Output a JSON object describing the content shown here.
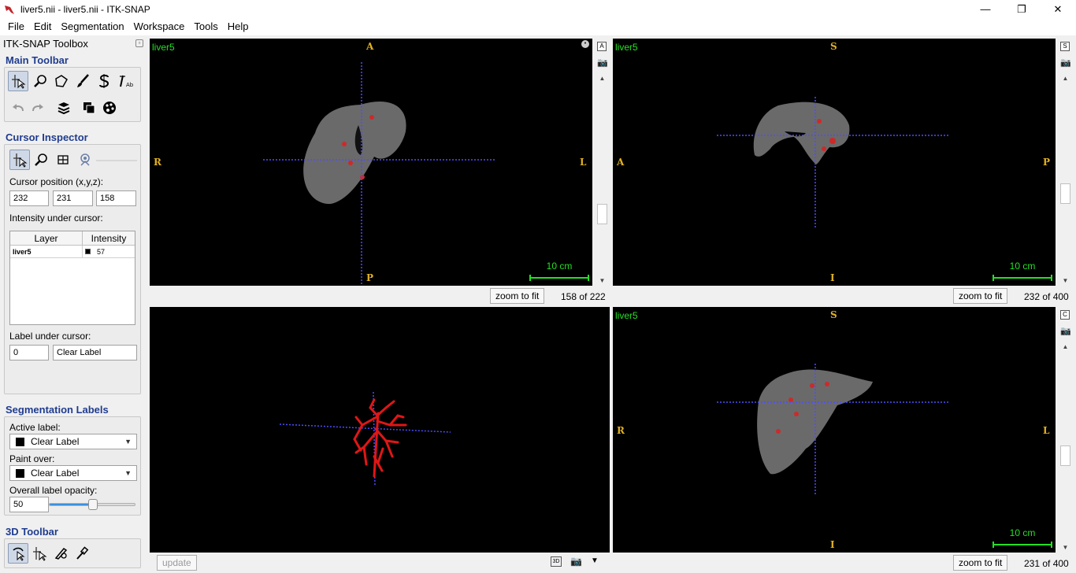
{
  "window": {
    "title": "liver5.nii - liver5.nii - ITK-SNAP",
    "minimize": "—",
    "maximize": "❐",
    "close": "✕"
  },
  "menu": [
    "File",
    "Edit",
    "Segmentation",
    "Workspace",
    "Tools",
    "Help"
  ],
  "toolbox": {
    "title": "ITK-SNAP Toolbox",
    "main_toolbar_title": "Main Toolbar",
    "cursor_inspector": {
      "title": "Cursor Inspector",
      "position_label": "Cursor position (x,y,z):",
      "x": "232",
      "y": "231",
      "z": "158",
      "intensity_label": "Intensity under cursor:",
      "columns": [
        "Layer",
        "Intensity"
      ],
      "rows": [
        {
          "layer": "liver5",
          "intensity": "57"
        }
      ],
      "label_under_cursor": "Label under cursor:",
      "label_id": "0",
      "label_name": "Clear Label"
    },
    "segmentation_labels": {
      "title": "Segmentation Labels",
      "active_label": "Active label:",
      "active_value": "Clear Label",
      "paint_over": "Paint over:",
      "paint_value": "Clear Label",
      "opacity_label": "Overall label opacity:",
      "opacity_value": "50",
      "opacity_level": 0.5
    },
    "toolbar3d_title": "3D Toolbar"
  },
  "views": {
    "axial": {
      "name": "liver5",
      "top": "A",
      "bottom": "P",
      "left": "R",
      "right": "L",
      "scale": "10 cm",
      "zoom_button": "zoom to fit",
      "slice": "158 of 222",
      "side_letter": "A"
    },
    "sagittal": {
      "name": "liver5",
      "top": "S",
      "bottom": "I",
      "left": "A",
      "right": "P",
      "scale": "10 cm",
      "zoom_button": "zoom to fit",
      "slice": "232 of 400",
      "side_letter": "S"
    },
    "view3d": {
      "update_button": "update",
      "mode_button": "3D"
    },
    "coronal": {
      "name": "liver5",
      "top": "S",
      "bottom": "I",
      "left": "R",
      "right": "L",
      "scale": "10 cm",
      "zoom_button": "zoom to fit",
      "slice": "231 of 400",
      "side_letter": "C"
    }
  }
}
